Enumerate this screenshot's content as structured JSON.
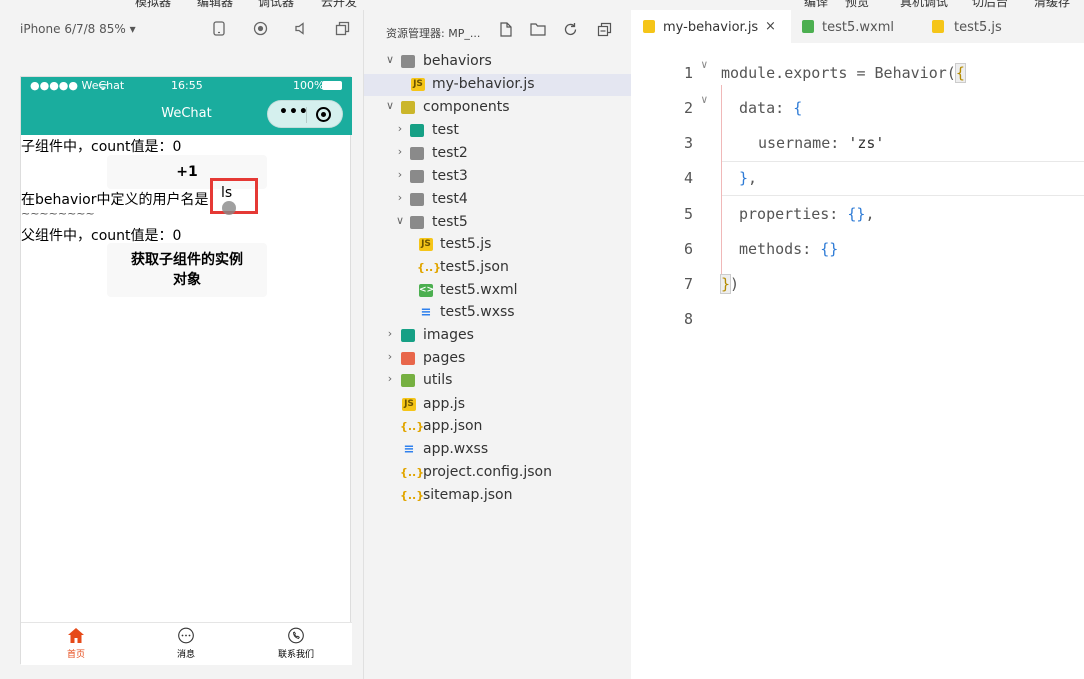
{
  "top_menu": [
    "模拟器",
    "编辑器",
    "调试器",
    "云开发",
    "编译",
    "预览",
    "真机调试",
    "切后台",
    "清缓存"
  ],
  "simulator": {
    "device_label": "iPhone 6/7/8 85% ▾",
    "status_left": "●●●●● WeChat",
    "status_time": "16:55",
    "status_battery": "100%",
    "nav_title": "WeChat",
    "capsule_dots": "•••",
    "lines": {
      "child_count": "子组件中，count值是：0",
      "plus_one": "+1",
      "behavior_label": "在behavior中定义的用户名是：",
      "username": "ls",
      "tilde": "~~~~~~~~",
      "parent_count": "父组件中，count值是：0",
      "get_child_btn": "获取子组件的实例对象"
    },
    "tabs": [
      {
        "label": "首页",
        "icon": "home-icon"
      },
      {
        "label": "消息",
        "icon": "message-icon"
      },
      {
        "label": "联系我们",
        "icon": "phone-icon"
      }
    ]
  },
  "explorer": {
    "title": "资源管理器: MP_...",
    "rows": [
      {
        "label": "behaviors",
        "kind": "folder",
        "chevron": "∨"
      },
      {
        "label": "my-behavior.js",
        "kind": "js",
        "chevron": ""
      },
      {
        "label": "components",
        "kind": "folder-yellow",
        "chevron": "∨"
      },
      {
        "label": "test",
        "kind": "folder-teal",
        "chevron": "›"
      },
      {
        "label": "test2",
        "kind": "folder",
        "chevron": "›"
      },
      {
        "label": "test3",
        "kind": "folder",
        "chevron": "›"
      },
      {
        "label": "test4",
        "kind": "folder",
        "chevron": "›"
      },
      {
        "label": "test5",
        "kind": "folder",
        "chevron": "∨"
      },
      {
        "label": "test5.js",
        "kind": "js",
        "chevron": ""
      },
      {
        "label": "test5.json",
        "kind": "json",
        "chevron": ""
      },
      {
        "label": "test5.wxml",
        "kind": "wxml",
        "chevron": ""
      },
      {
        "label": "test5.wxss",
        "kind": "wxss",
        "chevron": ""
      },
      {
        "label": "images",
        "kind": "folder-teal",
        "chevron": "›"
      },
      {
        "label": "pages",
        "kind": "folder-red",
        "chevron": "›"
      },
      {
        "label": "utils",
        "kind": "folder-green",
        "chevron": "›"
      },
      {
        "label": "app.js",
        "kind": "js",
        "chevron": ""
      },
      {
        "label": "app.json",
        "kind": "json",
        "chevron": ""
      },
      {
        "label": "app.wxss",
        "kind": "wxss",
        "chevron": ""
      },
      {
        "label": "project.config.json",
        "kind": "json",
        "chevron": ""
      },
      {
        "label": "sitemap.json",
        "kind": "json",
        "chevron": ""
      }
    ]
  },
  "editor": {
    "tabs": [
      {
        "label": "my-behavior.js",
        "kind": "js",
        "active": true,
        "close": "×"
      },
      {
        "label": "test5.wxml",
        "kind": "wxml",
        "active": false
      },
      {
        "label": "test5.js",
        "kind": "js",
        "active": false
      }
    ],
    "line_numbers": [
      "1",
      "2",
      "3",
      "4",
      "5",
      "6",
      "7",
      "8"
    ],
    "code": {
      "l1a": "module.exports = Behavior(",
      "l1b": "{",
      "l2a": "data: ",
      "l2b": "{",
      "l3a": "username: ",
      "l3b": "'zs'",
      "l4a": "}",
      "l4b": ",",
      "l5a": "properties: ",
      "l5b": "{}",
      "l5c": ",",
      "l6a": "methods: ",
      "l6b": "{}",
      "l7a": "}",
      "l7b": ")"
    }
  }
}
